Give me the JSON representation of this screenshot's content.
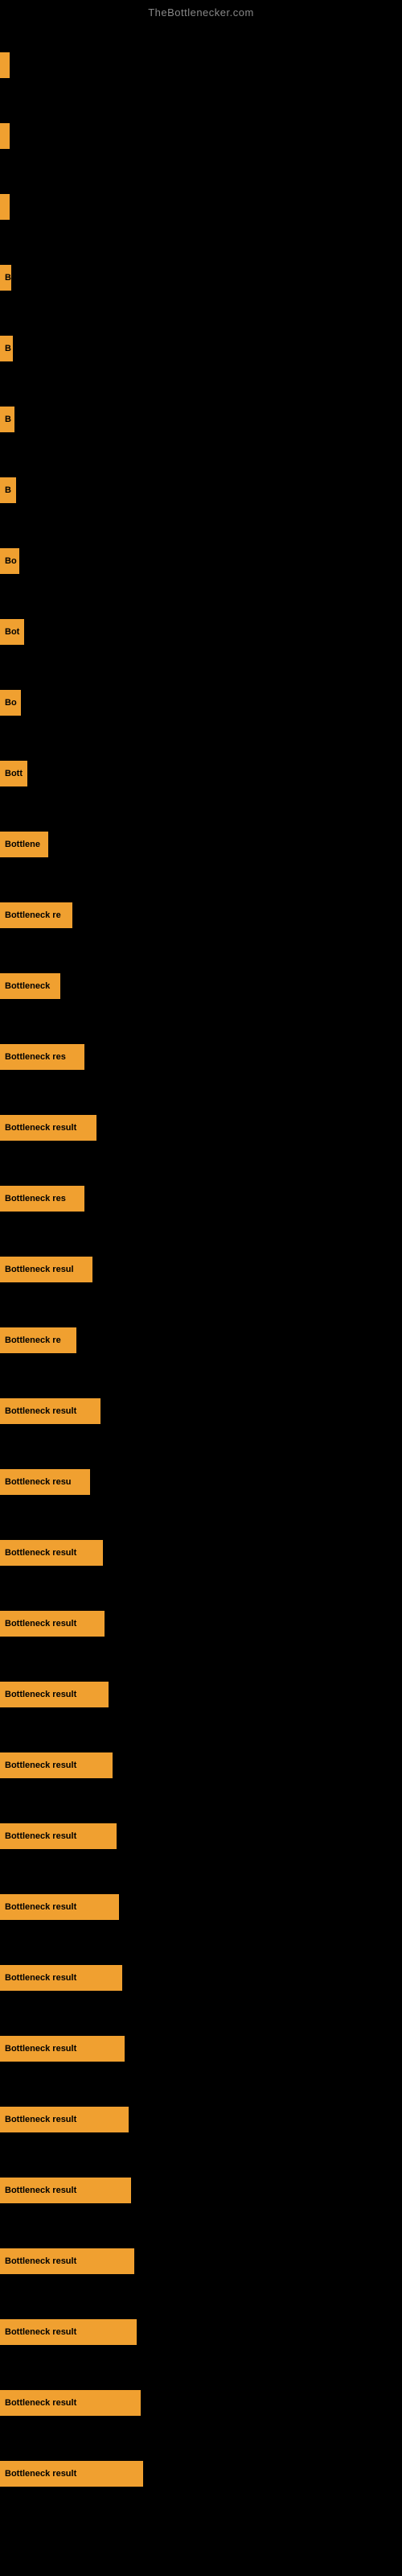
{
  "site": {
    "title": "TheBottlenecker.com"
  },
  "bars": [
    {
      "id": 1,
      "label": "",
      "width": 8
    },
    {
      "id": 2,
      "label": "",
      "width": 10
    },
    {
      "id": 3,
      "label": "",
      "width": 12
    },
    {
      "id": 4,
      "label": "B",
      "width": 14
    },
    {
      "id": 5,
      "label": "B",
      "width": 16
    },
    {
      "id": 6,
      "label": "B",
      "width": 18
    },
    {
      "id": 7,
      "label": "B",
      "width": 20
    },
    {
      "id": 8,
      "label": "Bo",
      "width": 24
    },
    {
      "id": 9,
      "label": "Bot",
      "width": 30
    },
    {
      "id": 10,
      "label": "Bo",
      "width": 26
    },
    {
      "id": 11,
      "label": "Bott",
      "width": 34
    },
    {
      "id": 12,
      "label": "Bottlene",
      "width": 60
    },
    {
      "id": 13,
      "label": "Bottleneck re",
      "width": 90
    },
    {
      "id": 14,
      "label": "Bottleneck",
      "width": 75
    },
    {
      "id": 15,
      "label": "Bottleneck res",
      "width": 105
    },
    {
      "id": 16,
      "label": "Bottleneck result",
      "width": 120
    },
    {
      "id": 17,
      "label": "Bottleneck res",
      "width": 105
    },
    {
      "id": 18,
      "label": "Bottleneck resul",
      "width": 115
    },
    {
      "id": 19,
      "label": "Bottleneck re",
      "width": 95
    },
    {
      "id": 20,
      "label": "Bottleneck result",
      "width": 125
    },
    {
      "id": 21,
      "label": "Bottleneck resu",
      "width": 112
    },
    {
      "id": 22,
      "label": "Bottleneck result",
      "width": 128
    },
    {
      "id": 23,
      "label": "Bottleneck result",
      "width": 130
    },
    {
      "id": 24,
      "label": "Bottleneck result",
      "width": 135
    },
    {
      "id": 25,
      "label": "Bottleneck result",
      "width": 140
    },
    {
      "id": 26,
      "label": "Bottleneck result",
      "width": 145
    },
    {
      "id": 27,
      "label": "Bottleneck result",
      "width": 148
    },
    {
      "id": 28,
      "label": "Bottleneck result",
      "width": 152
    },
    {
      "id": 29,
      "label": "Bottleneck result",
      "width": 155
    },
    {
      "id": 30,
      "label": "Bottleneck result",
      "width": 160
    },
    {
      "id": 31,
      "label": "Bottleneck result",
      "width": 163
    },
    {
      "id": 32,
      "label": "Bottleneck result",
      "width": 167
    },
    {
      "id": 33,
      "label": "Bottleneck result",
      "width": 170
    },
    {
      "id": 34,
      "label": "Bottleneck result",
      "width": 175
    },
    {
      "id": 35,
      "label": "Bottleneck result",
      "width": 178
    }
  ]
}
